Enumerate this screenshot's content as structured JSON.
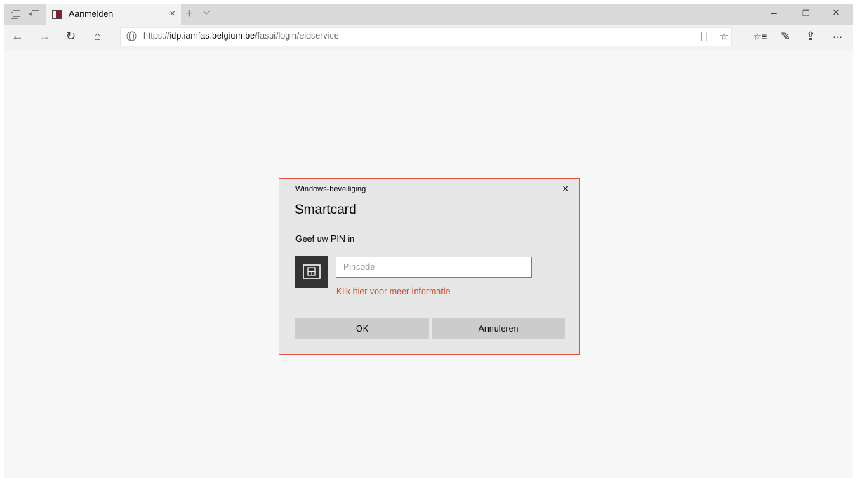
{
  "tabbar": {
    "tab_title": "Aanmelden",
    "tab_close": "×",
    "new_tab": "+",
    "window_controls": [
      "–",
      "❐",
      "×"
    ],
    "icons": [
      "tab-manager-icon",
      "tabs-aside-icon"
    ]
  },
  "navbar": {
    "back": "←",
    "forward": "→",
    "refresh": "↻",
    "home": "⌂",
    "url_prefix": "https://",
    "url_domain": "idp.iamfas.belgium.be",
    "url_path": "/fasui/login/eidservice",
    "favorite": "☆",
    "favorites_hub": "☆≡",
    "notes": "✎",
    "share": "⇪",
    "more": "···"
  },
  "dialog": {
    "caption": "Windows-beveiliging",
    "close": "×",
    "title": "Smartcard",
    "prompt": "Geef uw PIN in",
    "pin_placeholder": "Pincode",
    "more_info": "Klik hier voor meer informatie",
    "ok_label": "OK",
    "cancel_label": "Annuleren"
  },
  "colors": {
    "accent": "#e0533a",
    "link": "#d04b23",
    "dialog_bg": "#e6e6e6",
    "button_bg": "#cccccc",
    "page_bg": "#f7f7f7"
  }
}
